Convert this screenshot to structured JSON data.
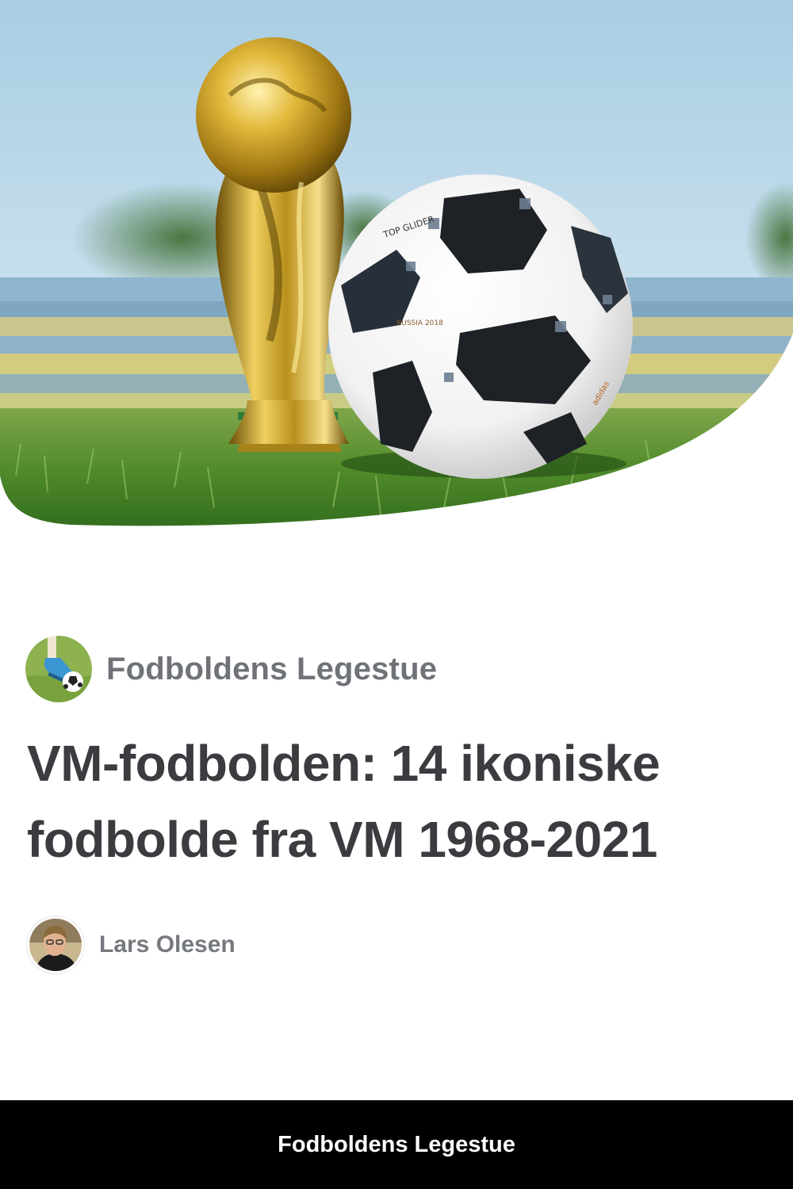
{
  "hero": {
    "image": "world-cup-trophy-and-ball",
    "ball_print": [
      "TOP GLIDER",
      "RUSSIA 2018",
      "adidas"
    ]
  },
  "publisher": {
    "name": "Fodboldens Legestue",
    "logo_icon": "football-kick-icon"
  },
  "article": {
    "title": "VM-fodbolden: 14 ikoniske fodbolde fra VM 1968-2021"
  },
  "author": {
    "name": "Lars Olesen",
    "avatar_icon": "author-portrait"
  },
  "footer": {
    "label": "Fodboldens Legestue"
  },
  "colors": {
    "title": "#3a3c40",
    "publisher": "#6f7378",
    "author": "#75797e",
    "footer_bg": "#000000",
    "footer_text": "#ffffff"
  }
}
